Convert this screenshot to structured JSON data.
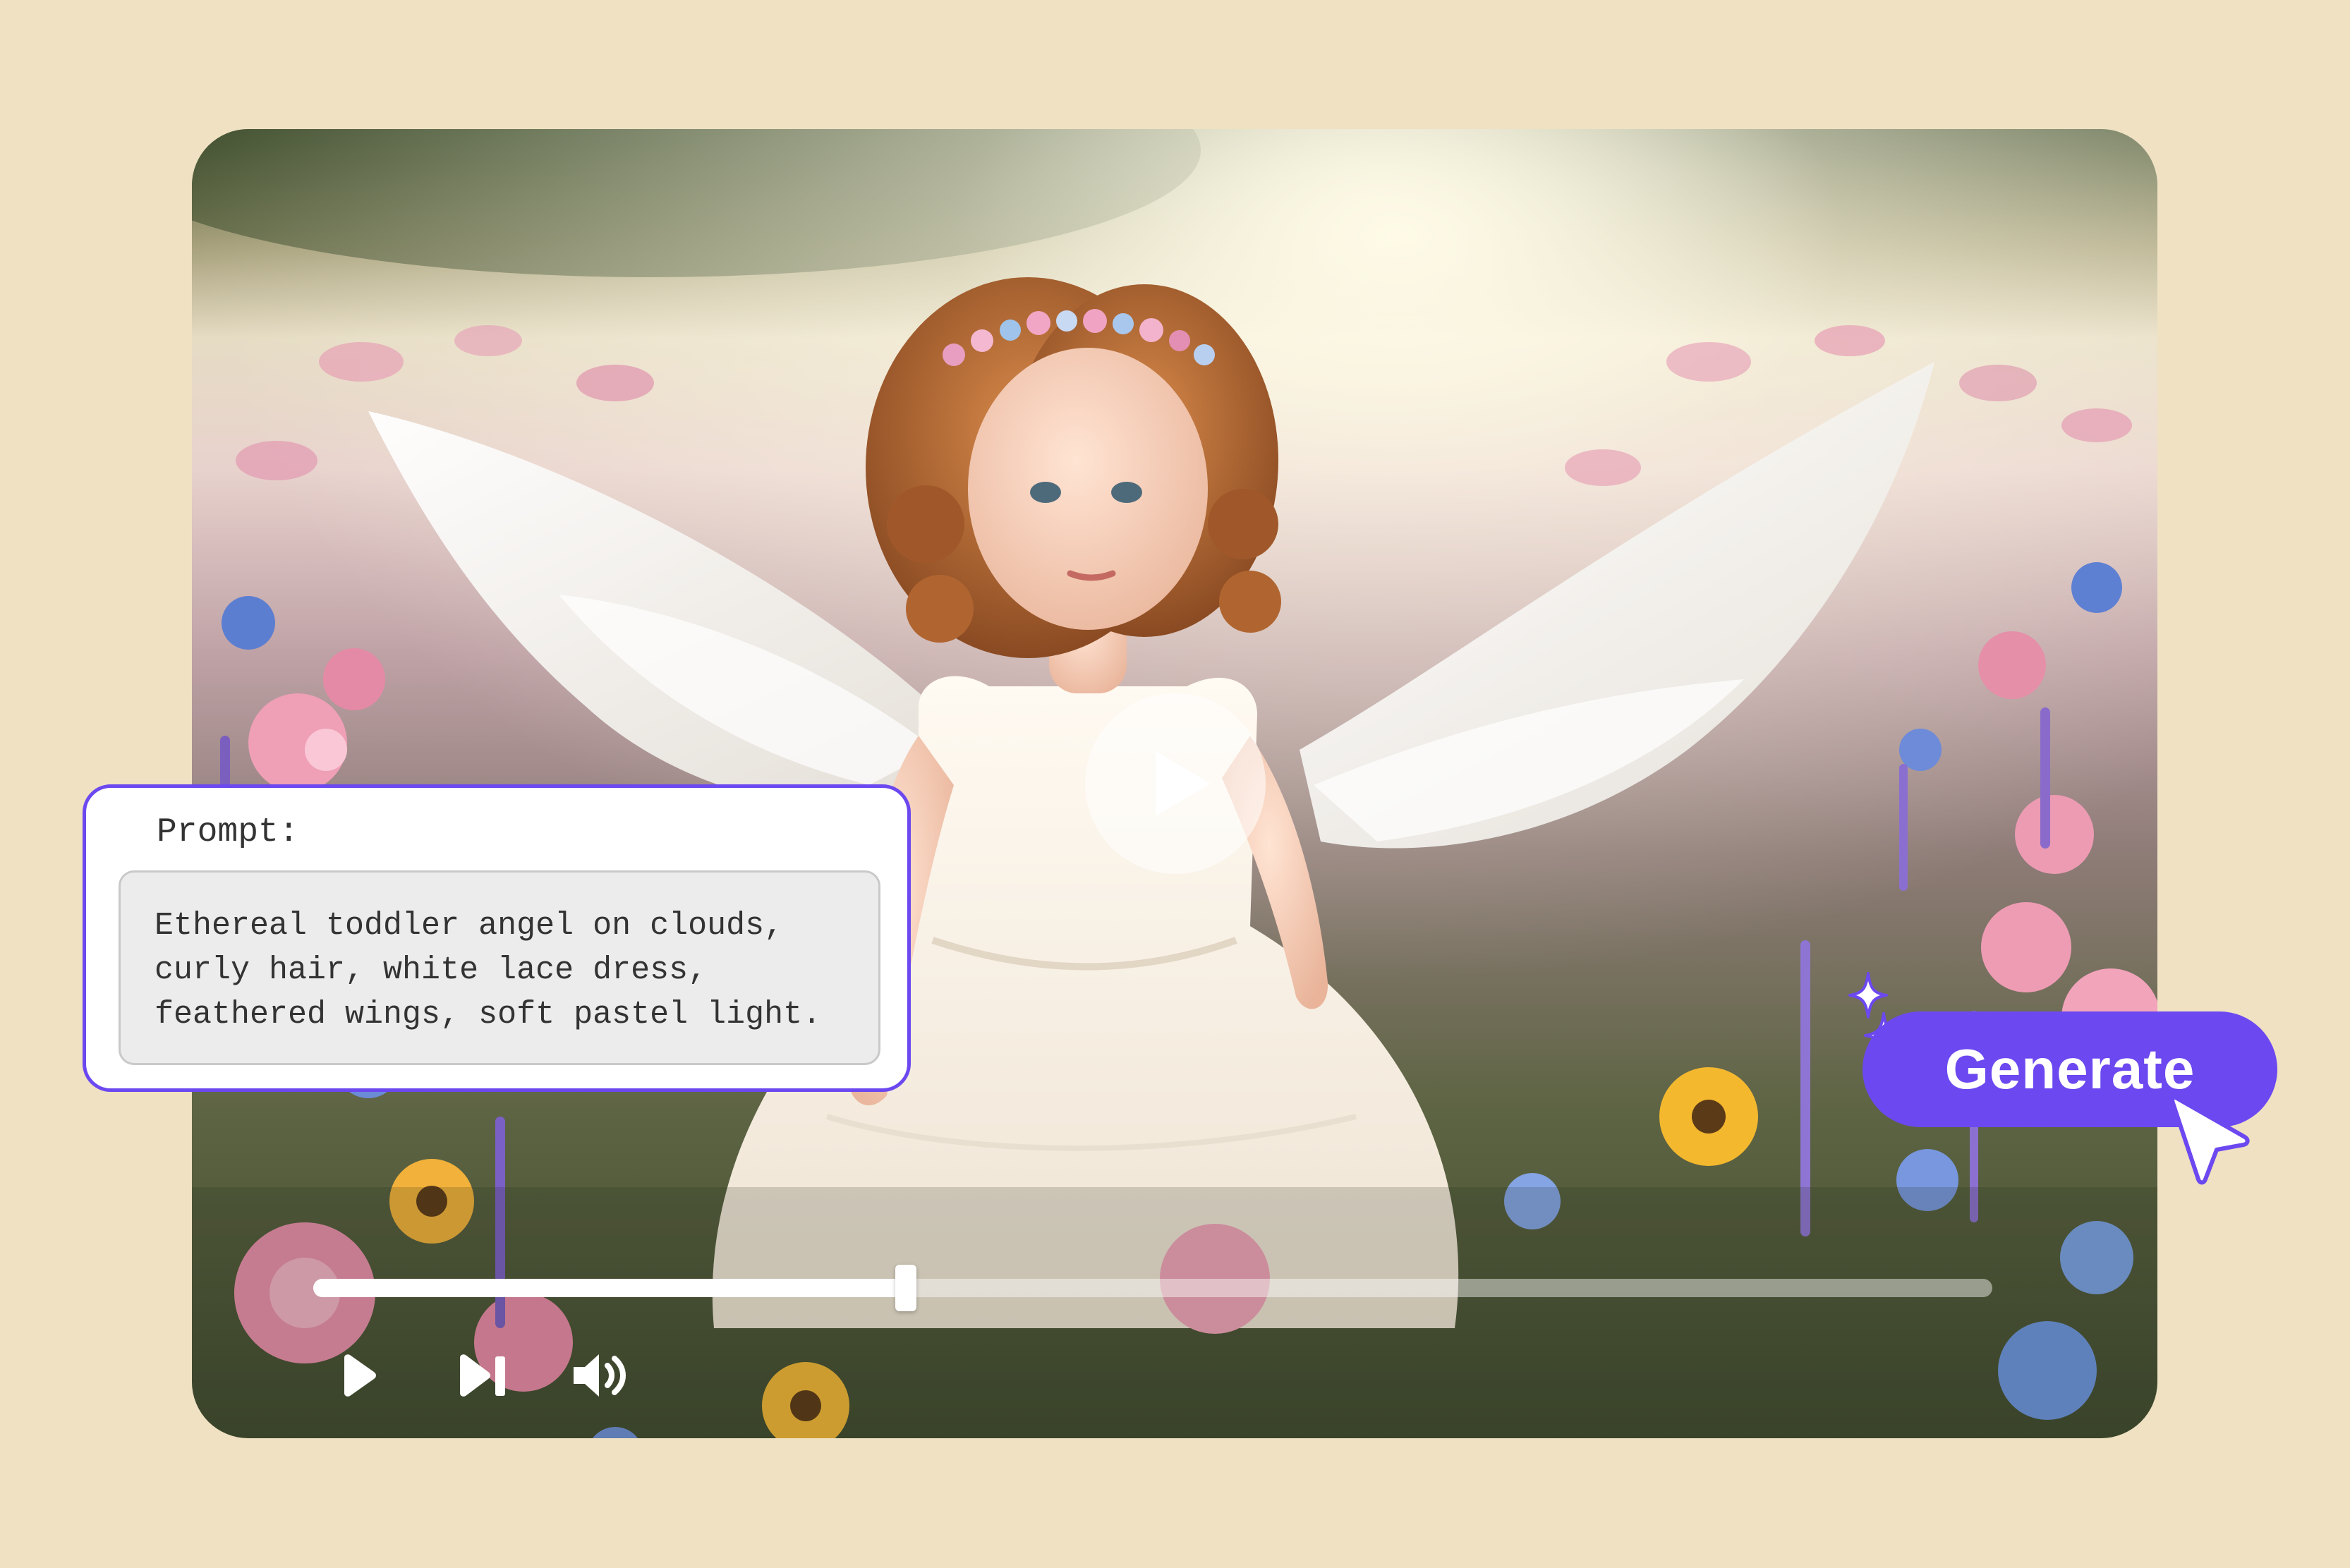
{
  "prompt": {
    "label": "Prompt:",
    "text": "Ethereal toddler angel on clouds,\ncurly hair, white lace dress,\nfeathered wings, soft pastel light."
  },
  "generate": {
    "label": "Generate"
  },
  "player": {
    "progress_fraction": 0.353,
    "controls": [
      "play-icon",
      "skip-next-icon",
      "volume-icon"
    ],
    "big_play_icon": "play-icon"
  },
  "colors": {
    "background": "#efe1c2",
    "accent": "#6c48f0",
    "prompt_box": "#ececec"
  }
}
